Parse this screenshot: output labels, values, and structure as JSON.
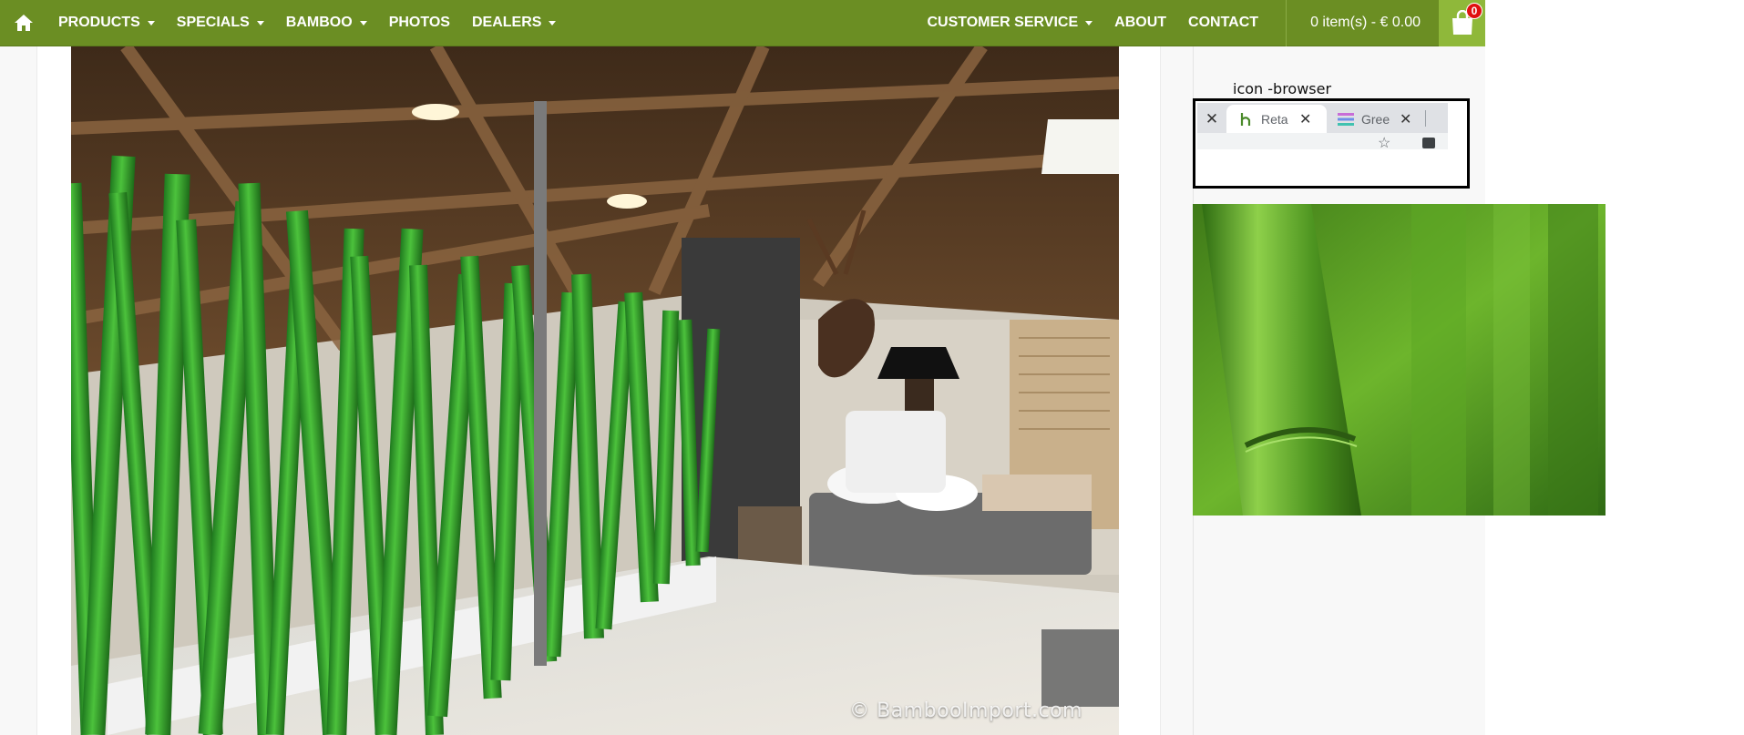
{
  "nav": {
    "home_icon": "home-icon",
    "items": [
      {
        "label": "PRODUCTS",
        "has_dropdown": true
      },
      {
        "label": "SPECIALS",
        "has_dropdown": true
      },
      {
        "label": "BAMBOO",
        "has_dropdown": true
      },
      {
        "label": "PHOTOS",
        "has_dropdown": false
      },
      {
        "label": "DEALERS",
        "has_dropdown": true
      }
    ],
    "right_items": [
      {
        "label": "CUSTOMER SERVICE",
        "has_dropdown": true
      },
      {
        "label": "ABOUT",
        "has_dropdown": false
      },
      {
        "label": "CONTACT",
        "has_dropdown": false
      }
    ],
    "cart": {
      "summary": "0 item(s) - € 0.00",
      "count": "0",
      "icon": "shopping-bag-icon"
    },
    "bar_color": "#6b8e23",
    "cart_button_color": "#8fb83a",
    "badge_color": "#e01010"
  },
  "main": {
    "watermark": "© BambooImport.com"
  },
  "sidebar": {
    "icon_label": "icon -browser",
    "browser": {
      "tabs": [
        {
          "title": "Reta",
          "favicon": "bamboo-leaf-favicon",
          "active": true
        },
        {
          "title": "Gree",
          "favicon": "hamburger-favicon",
          "active": false
        }
      ]
    }
  }
}
